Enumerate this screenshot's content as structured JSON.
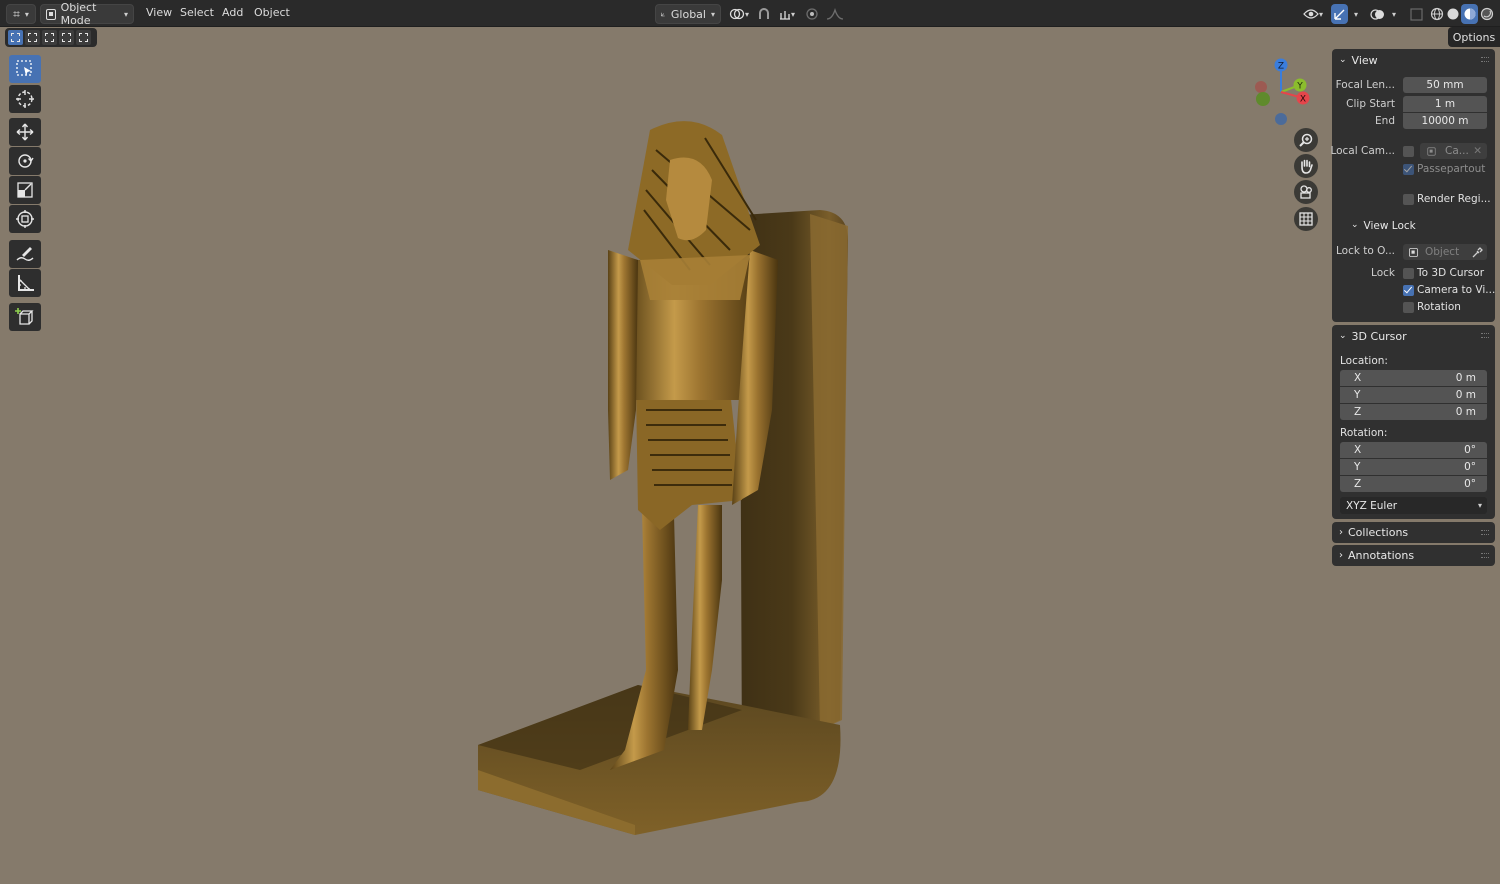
{
  "header": {
    "mode": "Object Mode",
    "menus": [
      "View",
      "Select",
      "Add",
      "Object"
    ],
    "transform_orientation": "Global",
    "options_label": "Options"
  },
  "sidebar": {
    "view": {
      "title": "View",
      "focal_length_label": "Focal Len...",
      "focal_length_value": "50 mm",
      "clip_start_label": "Clip Start",
      "clip_start_value": "1 m",
      "clip_end_label": "End",
      "clip_end_value": "10000 m",
      "local_camera_label": "Local Cam...",
      "local_camera_value": "Ca...",
      "passepartout_label": "Passepartout",
      "render_region_label": "Render Regi...",
      "view_lock_title": "View Lock",
      "lock_to_object_label": "Lock to O...",
      "lock_to_object_placeholder": "Object",
      "lock_label": "Lock",
      "to_3d_cursor_label": "To 3D Cursor",
      "camera_to_view_label": "Camera to Vi...",
      "camera_to_view_checked": true,
      "rotation_label": "Rotation"
    },
    "cursor": {
      "title": "3D Cursor",
      "location_label": "Location:",
      "loc_x_label": "X",
      "loc_x": "0 m",
      "loc_y_label": "Y",
      "loc_y": "0 m",
      "loc_z_label": "Z",
      "loc_z": "0 m",
      "rotation_label": "Rotation:",
      "rot_x_label": "X",
      "rot_x": "0°",
      "rot_y_label": "Y",
      "rot_y": "0°",
      "rot_z_label": "Z",
      "rot_z": "0°",
      "rotation_mode": "XYZ Euler"
    },
    "collections_title": "Collections",
    "annotations_title": "Annotations"
  },
  "gizmo": {
    "z_label": "Z",
    "y_label": "Y",
    "x_label": "X"
  },
  "colors": {
    "accent": "#4772b3",
    "axis_x": "#e5454b",
    "axis_y": "#8bbd2d",
    "axis_z": "#3a7ddc",
    "viewport_bg": "#857a6b"
  },
  "icons": [
    "editor-type-icon",
    "object-mode-icon",
    "transform-orientation-icon",
    "pivot-icon",
    "snap-icon",
    "proportional-edit-icon",
    "visibility-icon",
    "gizmo-icon",
    "overlay-icon",
    "xray-icon",
    "wireframe-shading-icon",
    "solid-shading-icon",
    "material-shading-icon",
    "rendered-shading-icon"
  ]
}
